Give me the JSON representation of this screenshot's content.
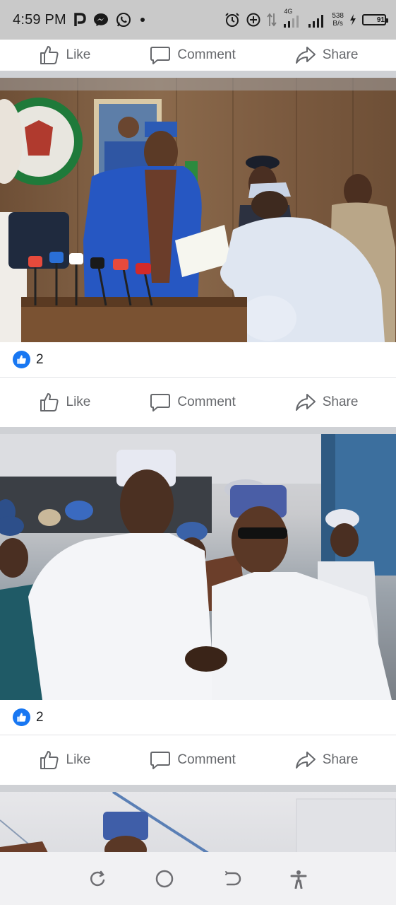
{
  "status_bar": {
    "time": "4:59 PM",
    "left_icons": [
      "pinterest-icon",
      "messenger-icon",
      "whatsapp-icon",
      "dot-icon"
    ],
    "right_icons": [
      "alarm-icon",
      "data-saver-icon",
      "data-arrows-icon",
      "signal-4g-icon",
      "signal-bars-icon",
      "charging-icon"
    ],
    "network_type": "4G",
    "net_speed_value": "538",
    "net_speed_unit": "B/s",
    "battery_level": "91"
  },
  "post_actions": {
    "like_label": "Like",
    "comment_label": "Comment",
    "share_label": "Share"
  },
  "posts": [
    {
      "reaction_icon": "like-reaction-icon",
      "reaction_count": "2"
    },
    {
      "reaction_icon": "like-reaction-icon",
      "reaction_count": "2"
    }
  ],
  "nav_bar": {
    "buttons": [
      "recent-apps-icon",
      "home-icon",
      "back-icon",
      "accessibility-icon"
    ]
  },
  "colors": {
    "accent": "#1877f2",
    "action_text": "#65676b",
    "separator": "#cfd1d5",
    "status_bar_bg": "#c9c9c9"
  }
}
